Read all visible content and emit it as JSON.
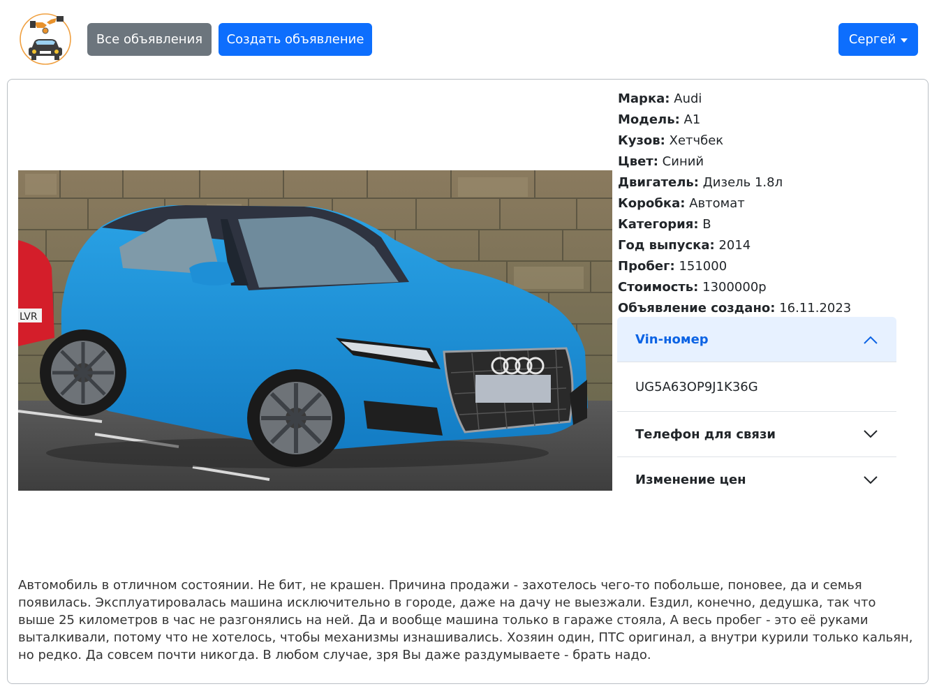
{
  "navbar": {
    "logo_icon": "car-sale-hands-logo",
    "all_listings_label": "Все объявления",
    "create_listing_label": "Создать объявление",
    "user_menu_label": "Сергей"
  },
  "listing": {
    "photo_icon": "blue-hatchback-car-photo",
    "plate_text": "LVR",
    "specs": [
      {
        "label": "Марка:",
        "value": "Audi"
      },
      {
        "label": "Модель:",
        "value": "A1"
      },
      {
        "label": "Кузов:",
        "value": "Хетчбек"
      },
      {
        "label": "Цвет:",
        "value": "Синий"
      },
      {
        "label": "Двигатель:",
        "value": "Дизель 1.8л"
      },
      {
        "label": "Коробка:",
        "value": "Автомат"
      },
      {
        "label": "Категория:",
        "value": "B"
      },
      {
        "label": "Год выпуска:",
        "value": "2014"
      },
      {
        "label": "Пробег:",
        "value": "151000"
      },
      {
        "label": "Стоимость:",
        "value": "1300000р"
      },
      {
        "label": "Объявление создано:",
        "value": "16.11.2023"
      }
    ],
    "accordion": [
      {
        "title": "Vin-номер",
        "expanded": true,
        "body": "UG5A63OP9J1K36G"
      },
      {
        "title": "Телефон для связи",
        "expanded": false
      },
      {
        "title": "Изменение цен",
        "expanded": false
      }
    ],
    "description": "Автомобиль в отличном состоянии. Не бит, не крашен. Причина продажи - захотелось чего-то побольше, поновее, да и семья появилась. Эксплуатировалась машина исключительно в городе, даже на дачу не выезжали. Ездил, конечно, дедушка, так что выше 25 километров в час не разгонялись на ней. Да и вообще машина только в гараже стояла, А весь пробег - это её руками выталкивали, потому что не хотелось, чтобы механизмы изнашивались. Хозяин один, ПТС оригинал, а внутри курили только кальян, но редко. Да совсем почти никогда. В любом случае, зря Вы даже раздумываете - брать надо."
  },
  "colors": {
    "primary": "#0d6efd",
    "secondary": "#6c757d",
    "accordion_active_bg": "#e7f1ff",
    "accordion_active_text": "#0c63e4",
    "car_body": "#1e8fd6"
  }
}
